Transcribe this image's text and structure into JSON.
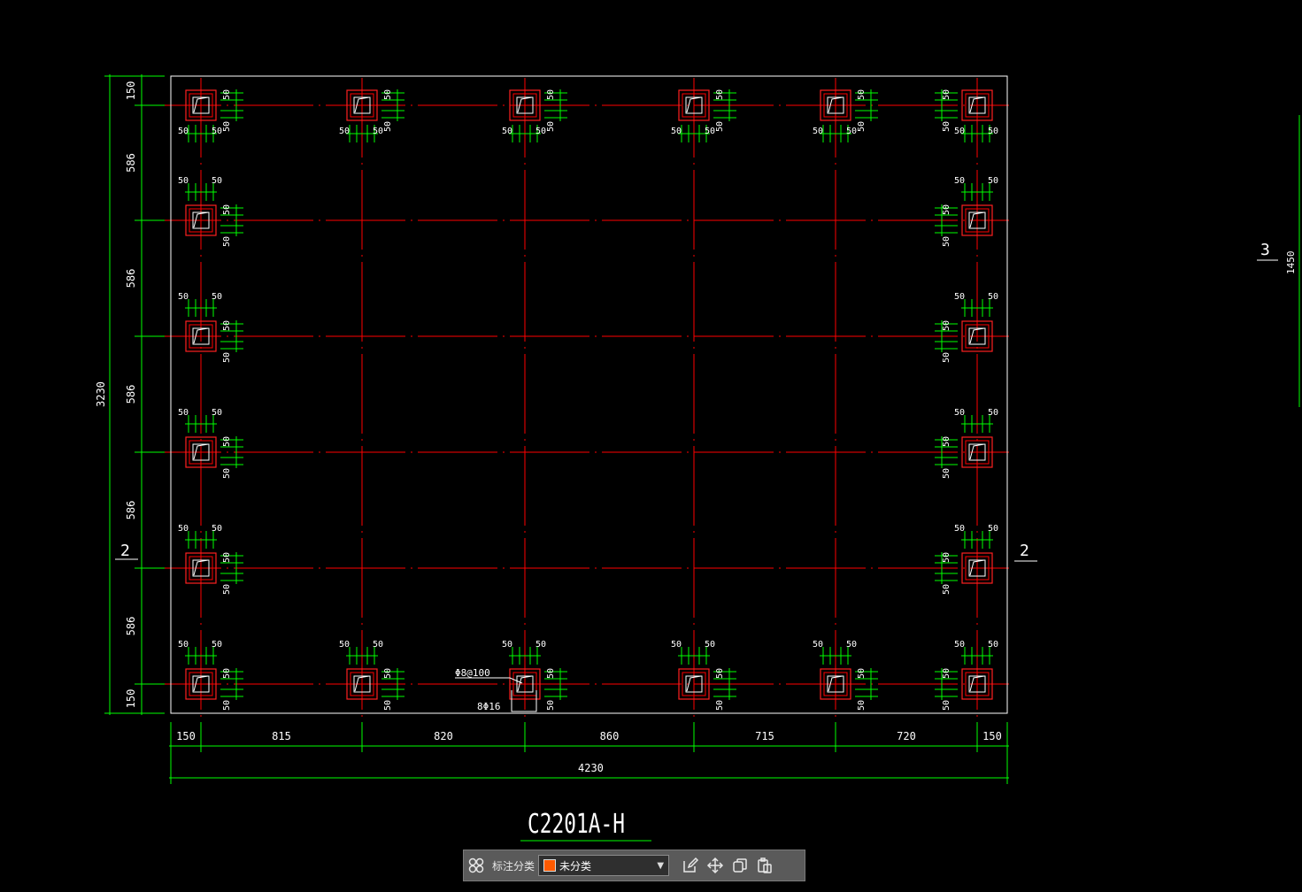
{
  "drawing": {
    "title": "C2201A-H",
    "section_left_label": "2",
    "section_right_label": "2",
    "section_far_label": "3",
    "far_dimension": "1450",
    "clearance_label": "50",
    "rebar_stirrup_label": "Φ8@100",
    "rebar_main_label": "8Φ16",
    "horizontal_dims": [
      "150",
      "815",
      "820",
      "860",
      "715",
      "720",
      "150"
    ],
    "overall_width": "4230",
    "vertical_dims": [
      "150",
      "586",
      "586",
      "586",
      "586",
      "586",
      "150"
    ],
    "overall_height": "3230"
  },
  "colors": {
    "background": "#000000",
    "dimension": "#00ff00",
    "grid": "#ff0000",
    "outline": "#ffffff",
    "column_border": "#ff2020",
    "category_swatch": "#ff5a00"
  },
  "toolbar": {
    "grid_icon": "grid-icon",
    "label": "标注分类",
    "selected_category": "未分类",
    "dropdown_icon": "chevron-down-icon",
    "edit_icon": "edit-icon",
    "move_icon": "move-icon",
    "copy_icon": "copy-icon",
    "paste_icon": "paste-icon"
  }
}
